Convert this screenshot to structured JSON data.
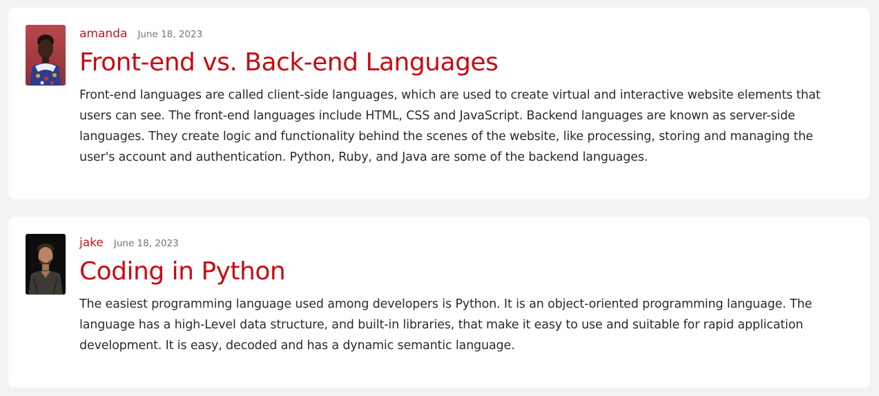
{
  "posts": [
    {
      "author": "amanda",
      "date": "June 18, 2023",
      "title": "Front-end vs. Back-end Languages",
      "content": "Front-end languages are called client-side languages, which are used to create virtual and interactive website elements that users can see. The front-end languages include HTML, CSS and JavaScript. Backend languages are known as server-side languages. They create logic and functionality behind the scenes of the website, like processing, storing and managing the user's account and authentication. Python, Ruby, and Java are some of the backend languages."
    },
    {
      "author": "jake",
      "date": "June 18, 2023",
      "title": "Coding in Python",
      "content": "The easiest programming language used among developers is Python. It is an object-oriented programming language. The language has a high-Level data structure, and built-in libraries, that make it easy to use and suitable for rapid application development. It is easy, decoded and has a dynamic semantic language."
    }
  ],
  "colors": {
    "accent": "#c80a12",
    "page_background": "#f2f2f2",
    "card_background": "#ffffff",
    "muted_text": "#6c757d",
    "body_text": "#2b2b2b"
  }
}
